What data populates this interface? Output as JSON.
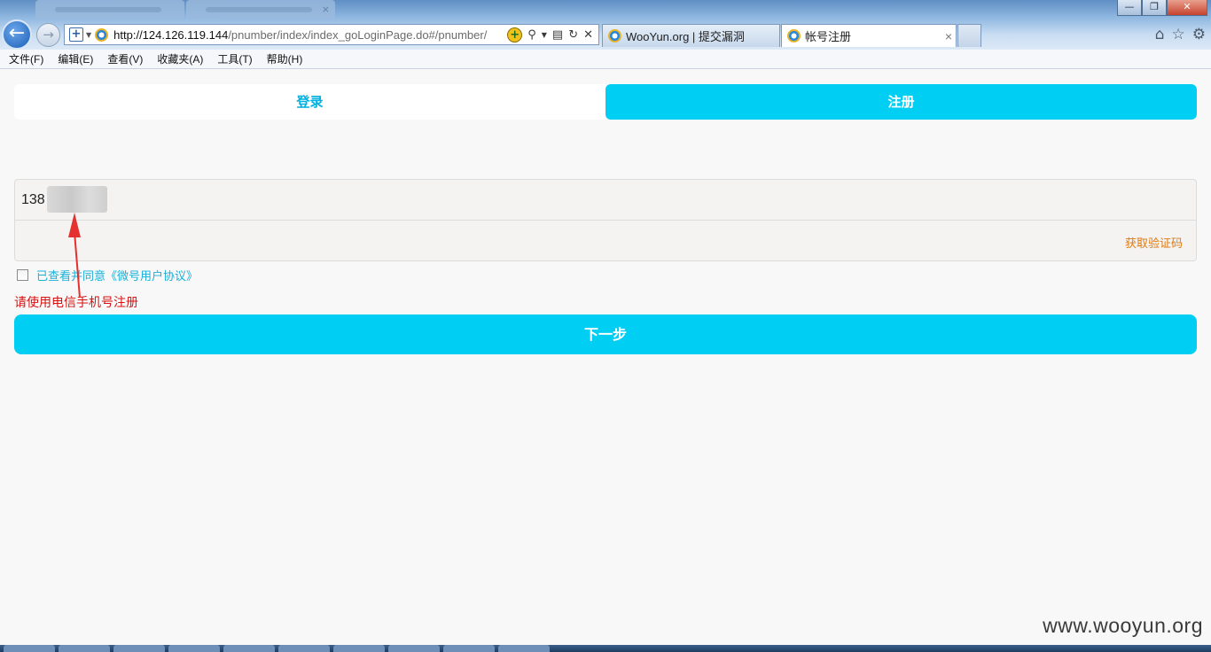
{
  "browser": {
    "address_url_domain": "http://124.126.119.144",
    "address_url_path": "/pnumber/index/index_goLoginPage.do#/pnumber/",
    "tabs": [
      {
        "label": "WooYun.org | 提交漏洞",
        "active": false
      },
      {
        "label": "帐号注册",
        "active": true
      }
    ],
    "close_tab_glyph": "×"
  },
  "menu": [
    "文件(F)",
    "编辑(E)",
    "查看(V)",
    "收藏夹(A)",
    "工具(T)",
    "帮助(H)"
  ],
  "segmented": {
    "login_label": "登录",
    "register_label": "注册",
    "active": "register"
  },
  "form": {
    "phone_value": "138",
    "get_code_label": "获取验证码",
    "agree_text": "已查看并同意《微号用户协议》",
    "agree_checked": false,
    "hint_text": "请使用电信手机号注册",
    "next_label": "下一步"
  },
  "watermark": "www.wooyun.org",
  "colors": {
    "accent": "#00cef2",
    "link": "#1ab0d8",
    "warning": "#d81313",
    "code_link": "#e07a10"
  }
}
